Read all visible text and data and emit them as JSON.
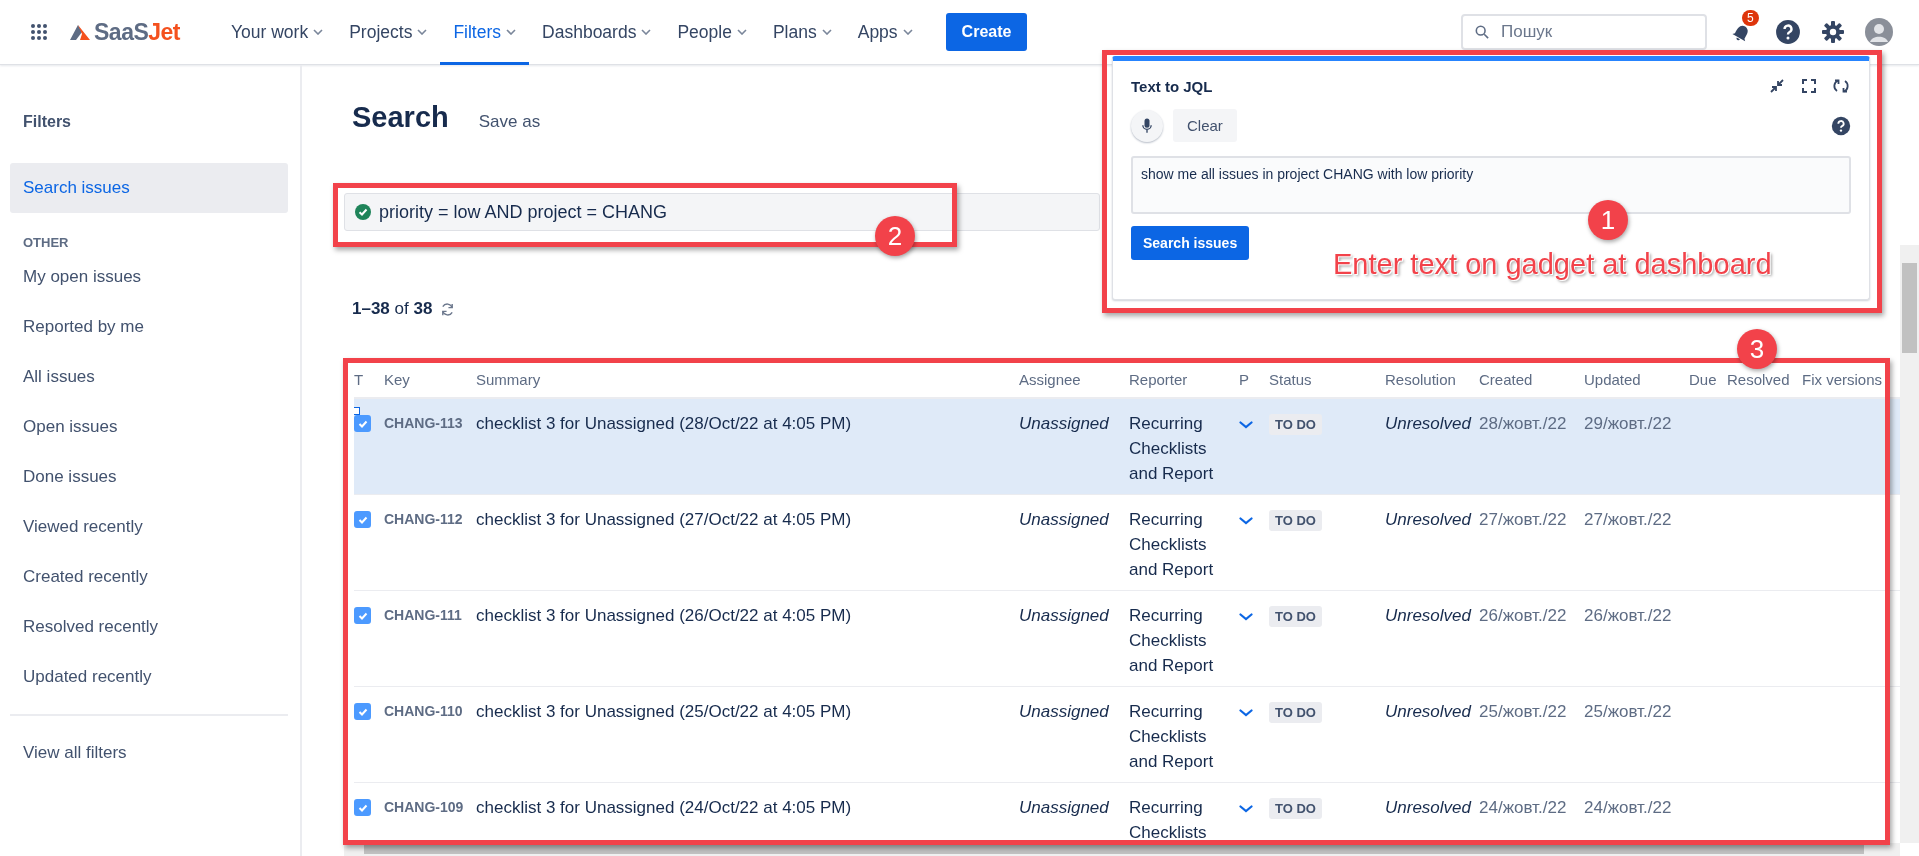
{
  "nav": {
    "logo": {
      "first": "SaaS",
      "second": "Jet"
    },
    "items": [
      {
        "label": "Your work",
        "selected": false
      },
      {
        "label": "Projects",
        "selected": false
      },
      {
        "label": "Filters",
        "selected": true
      },
      {
        "label": "Dashboards",
        "selected": false
      },
      {
        "label": "People",
        "selected": false
      },
      {
        "label": "Plans",
        "selected": false
      },
      {
        "label": "Apps",
        "selected": false
      }
    ],
    "create": "Create",
    "search": {
      "placeholder": "Пошук"
    },
    "notifications": "5"
  },
  "sidebar": {
    "title": "Filters",
    "items": [
      {
        "label": "Search issues",
        "selected": true
      }
    ],
    "section": "OTHER",
    "other": [
      {
        "label": "My open issues",
        "selected": false
      },
      {
        "label": "Reported by me",
        "selected": false
      },
      {
        "label": "All issues",
        "selected": false
      },
      {
        "label": "Open issues",
        "selected": false
      },
      {
        "label": "Done issues",
        "selected": false
      },
      {
        "label": "Viewed recently",
        "selected": false
      },
      {
        "label": "Created recently",
        "selected": false
      },
      {
        "label": "Resolved recently",
        "selected": false
      },
      {
        "label": "Updated recently",
        "selected": false
      }
    ],
    "footer": "View all filters"
  },
  "header": {
    "title": "Search",
    "save_as": "Save as"
  },
  "jql": {
    "query": "priority = low AND project = CHANG",
    "valid": true
  },
  "count": "**1–38** of **38**",
  "table": {
    "columns": [
      "T",
      "Key",
      "Summary",
      "Assignee",
      "Reporter",
      "P",
      "Status",
      "Resolution",
      "Created",
      "Updated",
      "Due",
      "Resolved",
      "Fix versions"
    ],
    "rows": [
      {
        "checked": true,
        "selected": true,
        "key": "CHANG-113",
        "summary": "checklist 3 for Unassigned (28/Oct/22 at 4:05 PM)",
        "assignee": "Unassigned",
        "reporter": "Recurring Checklists and Report",
        "status": "TO DO",
        "resolution": "Unresolved",
        "created": "28/жовт./22",
        "updated": "29/жовт./22"
      },
      {
        "checked": true,
        "selected": false,
        "key": "CHANG-112",
        "summary": "checklist 3 for Unassigned (27/Oct/22 at 4:05 PM)",
        "assignee": "Unassigned",
        "reporter": "Recurring Checklists and Report",
        "status": "TO DO",
        "resolution": "Unresolved",
        "created": "27/жовт./22",
        "updated": "27/жовт./22"
      },
      {
        "checked": true,
        "selected": false,
        "key": "CHANG-111",
        "summary": "checklist 3 for Unassigned (26/Oct/22 at 4:05 PM)",
        "assignee": "Unassigned",
        "reporter": "Recurring Checklists and Report",
        "status": "TO DO",
        "resolution": "Unresolved",
        "created": "26/жовт./22",
        "updated": "26/жовт./22"
      },
      {
        "checked": true,
        "selected": false,
        "key": "CHANG-110",
        "summary": "checklist 3 for Unassigned (25/Oct/22 at 4:05 PM)",
        "assignee": "Unassigned",
        "reporter": "Recurring Checklists and Report",
        "status": "TO DO",
        "resolution": "Unresolved",
        "created": "25/жовт./22",
        "updated": "25/жовт./22"
      },
      {
        "checked": true,
        "selected": false,
        "key": "CHANG-109",
        "summary": "checklist 3 for Unassigned (24/Oct/22 at 4:05 PM)",
        "assignee": "Unassigned",
        "reporter": "Recurring Checklists",
        "status": "TO DO",
        "resolution": "Unresolved",
        "created": "24/жовт./22",
        "updated": "24/жовт./22"
      }
    ]
  },
  "gadget": {
    "title": "Text to JQL",
    "clear": "Clear",
    "value": "show me all issues in project CHANG with low priority",
    "search": "Search issues"
  },
  "annotations": [
    {
      "label": "1"
    },
    {
      "label": "2"
    },
    {
      "label": "3"
    }
  ],
  "caption": "Enter text on gadget at dashboard"
}
